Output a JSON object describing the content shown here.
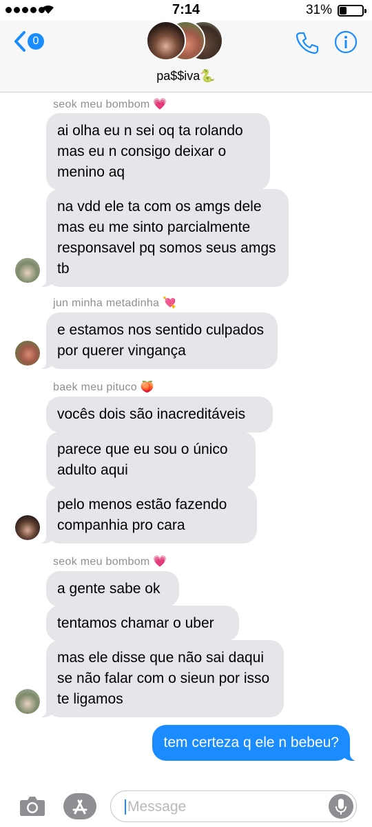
{
  "status_bar": {
    "time": "7:14",
    "battery": "31%",
    "battery_level": 0.31
  },
  "header": {
    "back_count": "0",
    "title": "pa$$iva🐍"
  },
  "groups": [
    {
      "sender": "seok meu bombom 💗",
      "messages": [
        "ai olha eu n sei oq ta rolando mas eu n consigo deixar o menino aq",
        "na vdd ele ta com os amgs dele mas eu me sinto parcialmente responsavel pq somos seus amgs tb"
      ]
    },
    {
      "sender": "jun minha metadinha 💘",
      "messages": [
        "e estamos nos sentido culpados por querer vingança"
      ]
    },
    {
      "sender": "baek meu pituco 🍑",
      "messages": [
        "vocês dois são inacreditáveis",
        "parece que eu sou o único adulto aqui",
        "pelo menos estão fazendo companhia pro cara"
      ]
    },
    {
      "sender": "seok meu bombom 💗",
      "messages": [
        "a gente sabe ok",
        "tentamos chamar o uber",
        "mas ele disse que não sai daqui se não falar com o sieun por isso te ligamos"
      ]
    }
  ],
  "outgoing": "tem certeza q ele n bebeu?",
  "composer": {
    "placeholder": "Message"
  },
  "colors": {
    "accent": "#1a8cff",
    "incoming_bubble": "#e5e5ea",
    "sender_label": "#8e8e93"
  }
}
